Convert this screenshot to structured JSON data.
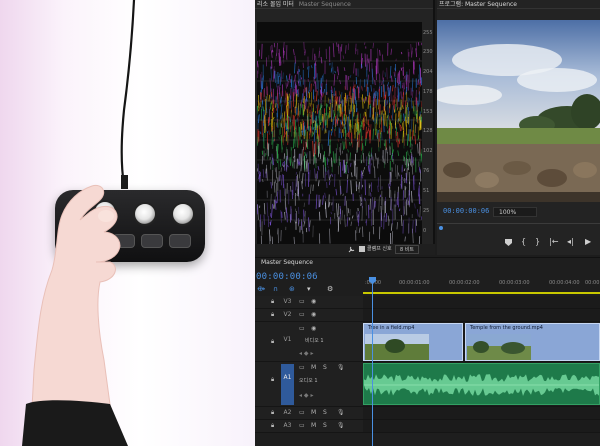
{
  "scope_panel": {
    "tab_active": "리소 몰입 미터",
    "tab_sequence": "Master Sequence",
    "scale": [
      "255",
      "230",
      "204",
      "178",
      "153",
      "128",
      "102",
      "76",
      "51",
      "25",
      "0"
    ],
    "checkbox_label": "클램프 신호",
    "bit_depth": "8 비트"
  },
  "program_panel": {
    "tab": "프로그램: Master Sequence",
    "timecode": "00:00:00:06",
    "zoom": "100%"
  },
  "timeline": {
    "tab": "Master Sequence",
    "timecode": "00:00:00:06",
    "ruler": [
      ":00:00",
      "00:00:01:00",
      "00:00:02:00",
      "00:00:03:00",
      "00:00:04:00",
      "00:00"
    ],
    "tracks": {
      "v3": "V3",
      "v2": "V2",
      "v1": "V1",
      "v1_sub": "비디오 1",
      "a1": "A1",
      "a1_sub": "오디오 1",
      "a2": "A2",
      "a3": "A3",
      "mute": "M",
      "solo": "S"
    },
    "clips": {
      "clip1": "Tree in a field.mp4",
      "clip2": "Temple from the ground.mp4"
    }
  },
  "colors": {
    "accent_blue": "#4a90e2",
    "video_clip": "#8aa6d6",
    "audio_clip": "#1e7a4a",
    "target_track": "#2f5a9b"
  },
  "icons": {
    "wrench": "wrench-icon",
    "marker": "marker-icon",
    "step_back": "step-back-icon",
    "play": "play-icon"
  }
}
